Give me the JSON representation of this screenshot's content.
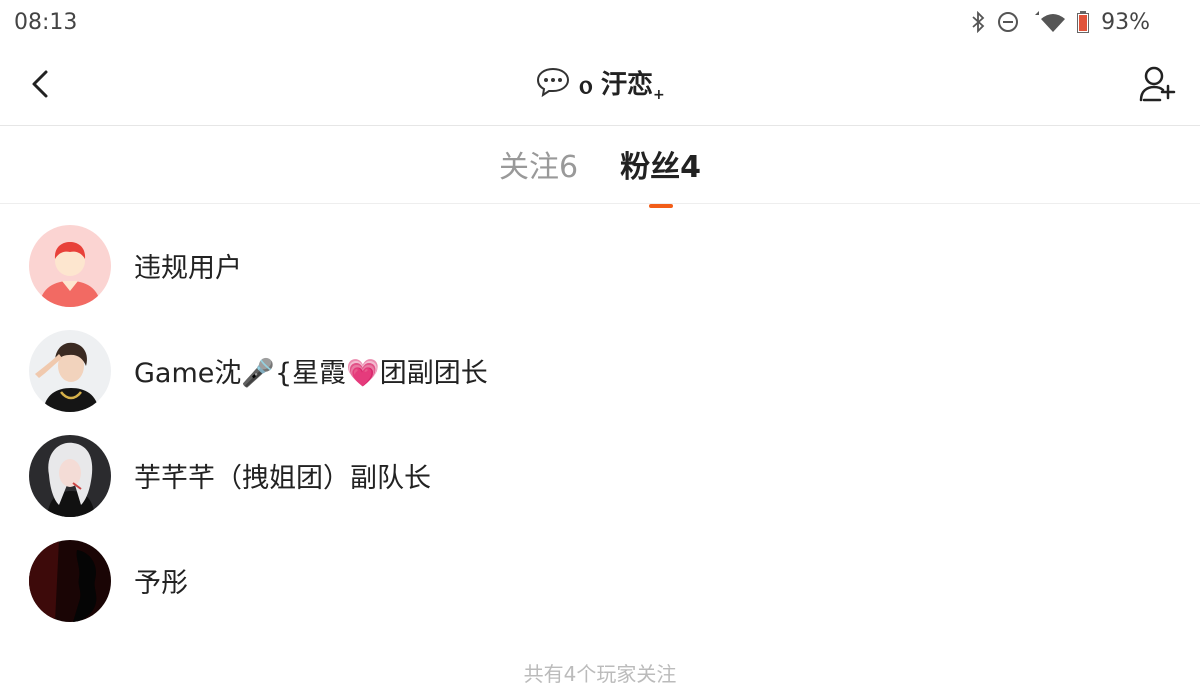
{
  "status_bar": {
    "time": "08:13",
    "battery": "93%",
    "icons": [
      "bluetooth-icon",
      "do-not-disturb-icon",
      "wifi-icon",
      "battery-icon"
    ]
  },
  "nav": {
    "title": "ⲟ 汙恋",
    "title_suffix": "+",
    "back_icon": "chevron-left-icon",
    "title_icon": "chat-bubble-icon",
    "add_user_icon": "add-user-icon"
  },
  "tabs": [
    {
      "label": "关注6",
      "active": false
    },
    {
      "label": "粉丝4",
      "active": true
    }
  ],
  "accent_color": "#f25d18",
  "followers": [
    {
      "name": "违规用户",
      "avatar": "default-avatar"
    },
    {
      "name": "Game沈🎤{星霞💗团副团长",
      "avatar": "user-avatar"
    },
    {
      "name": "芋芊芊（拽姐团）副队长",
      "avatar": "user-avatar"
    },
    {
      "name": "予彤",
      "avatar": "user-avatar"
    }
  ],
  "footer_text": "共有4个玩家关注"
}
